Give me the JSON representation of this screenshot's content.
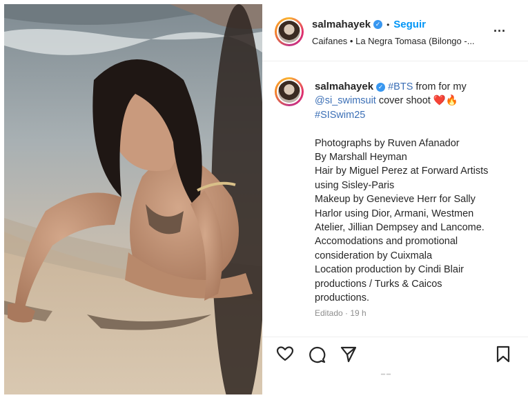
{
  "post": {
    "username": "salmahayek",
    "follow_label": "Seguir",
    "audio": "Caifanes • La Negra Tomasa (Bilongo -...",
    "caption": {
      "username": "salmahayek",
      "hashtag_bts": "#BTS",
      "text_1": " from for my",
      "mention": "@si_swimsuit",
      "text_2": " cover shoot ❤️🔥",
      "hashtag_siswim": "#SISwim25",
      "credits": [
        "Photographs by Ruven Afanador",
        "By Marshall Heyman",
        "Hair by Miguel Perez at Forward Artists",
        "using Sisley-Paris",
        "Makeup by Genevieve Herr for Sally",
        "Harlor using Dior, Armani, Westmen",
        "Atelier, Jillian Dempsey and Lancome.",
        "Accomodations and promotional",
        "consideration by Cuixmala",
        "Location production by Cindi Blair",
        "productions / Turks & Caicos",
        "productions."
      ]
    },
    "edited_label": "Editado",
    "time_ago": "19 h",
    "more_options": "...",
    "icons": {
      "verified": "verified-badge-icon",
      "like": "heart-icon",
      "comment": "comment-icon",
      "share": "paper-plane-icon",
      "save": "bookmark-icon"
    },
    "colors": {
      "link": "#00376b",
      "follow": "#0095f6",
      "hashtag": "#3b6fb6",
      "verified": "#3897f0"
    }
  }
}
